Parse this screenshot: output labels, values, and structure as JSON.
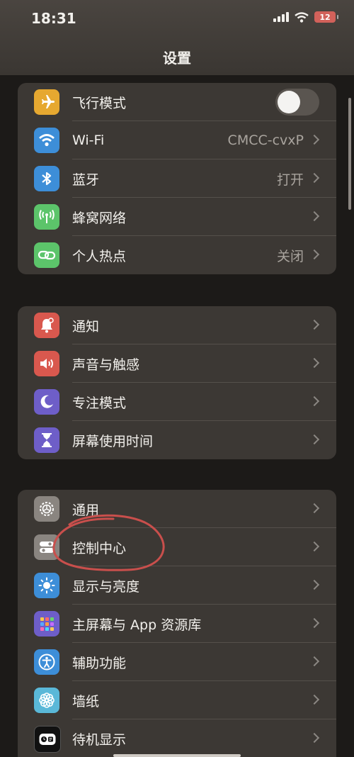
{
  "status_bar": {
    "time": "18:31",
    "battery": "12"
  },
  "page_title": "设置",
  "groups": [
    {
      "rows": [
        {
          "label": "飞行模式",
          "icon": "airplane-icon",
          "color": "#e6a830",
          "toggle": false
        },
        {
          "label": "Wi-Fi",
          "value": "CMCC-cvxP",
          "icon": "wifi-icon",
          "color": "#3d8ed8"
        },
        {
          "label": "蓝牙",
          "value": "打开",
          "icon": "bluetooth-icon",
          "color": "#3d8ed8"
        },
        {
          "label": "蜂窝网络",
          "value": "",
          "icon": "cellular-icon",
          "color": "#5cc46a"
        },
        {
          "label": "个人热点",
          "value": "关闭",
          "icon": "hotspot-icon",
          "color": "#5cc46a"
        }
      ]
    },
    {
      "rows": [
        {
          "label": "通知",
          "icon": "bell-icon",
          "color": "#d9584e"
        },
        {
          "label": "声音与触感",
          "icon": "speaker-icon",
          "color": "#d9584e"
        },
        {
          "label": "专注模式",
          "icon": "moon-icon",
          "color": "#6e5ec8"
        },
        {
          "label": "屏幕使用时间",
          "icon": "hourglass-icon",
          "color": "#6e5ec8"
        }
      ]
    },
    {
      "rows": [
        {
          "label": "通用",
          "icon": "gear-icon",
          "color": "#8a8580"
        },
        {
          "label": "控制中心",
          "icon": "switches-icon",
          "color": "#8a8580"
        },
        {
          "label": "显示与亮度",
          "icon": "sun-icon",
          "color": "#3d8ed8"
        },
        {
          "label": "主屏幕与 App 资源库",
          "icon": "app-grid-icon",
          "color": "#6e5ec8"
        },
        {
          "label": "辅助功能",
          "icon": "accessibility-icon",
          "color": "#3d8ed8"
        },
        {
          "label": "墙纸",
          "icon": "flower-icon",
          "color": "#5ab8d8"
        },
        {
          "label": "待机显示",
          "icon": "standby-icon",
          "color": "#111111"
        }
      ]
    }
  ]
}
